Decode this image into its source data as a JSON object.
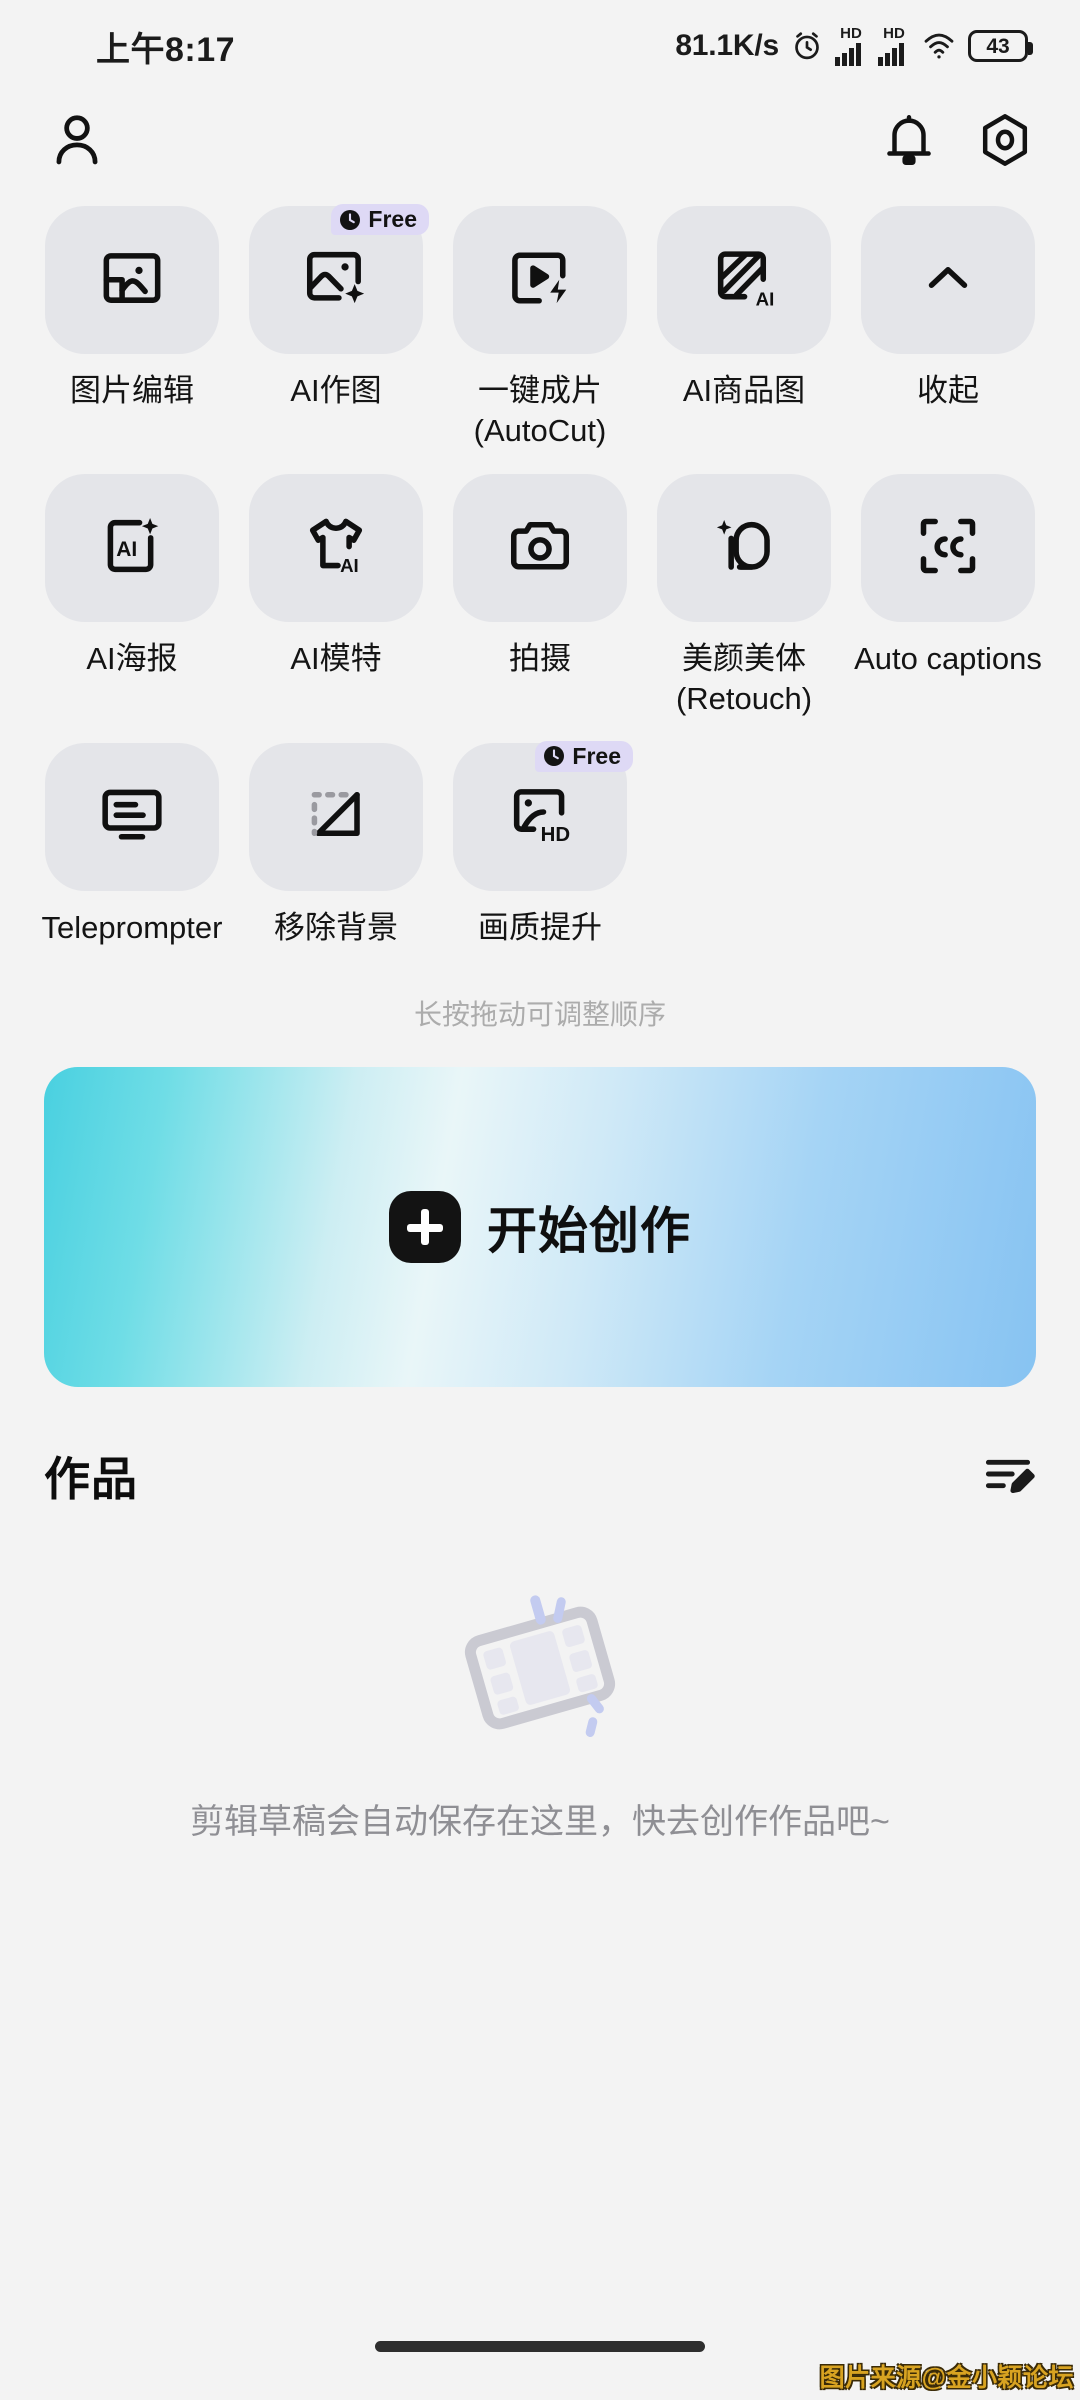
{
  "status_bar": {
    "time": "上午8:17",
    "network_speed": "81.1K/s",
    "alarm_icon": "alarm-clock-icon",
    "signal_1_label": "HD",
    "signal_2_label": "HD",
    "wifi_icon": "wifi-icon",
    "battery_level": "43"
  },
  "top_nav": {
    "profile_icon": "person-icon",
    "notification_icon": "bell-icon",
    "settings_icon": "settings-hex-icon"
  },
  "tools": [
    {
      "label": "图片编辑",
      "icon": "image-edit-icon",
      "badge": null
    },
    {
      "label": "AI作图",
      "icon": "ai-image-sparkle-icon",
      "badge": "Free"
    },
    {
      "label": "一键成片\n(AutoCut)",
      "icon": "autocut-play-bolt-icon",
      "badge": null
    },
    {
      "label": "AI商品图",
      "icon": "ai-product-image-icon",
      "badge": null
    },
    {
      "label": "收起",
      "icon": "chevron-up-icon",
      "badge": null
    },
    {
      "label": "AI海报",
      "icon": "ai-poster-icon",
      "badge": null
    },
    {
      "label": "AI模特",
      "icon": "ai-model-shirt-icon",
      "badge": null
    },
    {
      "label": "拍摄",
      "icon": "camera-icon",
      "badge": null
    },
    {
      "label": "美颜美体\n(Retouch)",
      "icon": "retouch-face-icon",
      "badge": null
    },
    {
      "label": "Auto captions",
      "icon": "closed-caption-icon",
      "badge": null
    },
    {
      "label": "Teleprompter",
      "icon": "teleprompter-icon",
      "badge": null
    },
    {
      "label": "移除背景",
      "icon": "remove-background-icon",
      "badge": null
    },
    {
      "label": "画质提升",
      "icon": "hd-enhance-icon",
      "badge": "Free"
    }
  ],
  "grid_hint": "长按拖动可调整顺序",
  "create_button": {
    "label": "开始创作",
    "icon": "plus-icon",
    "gradient_start": "#49d0e0",
    "gradient_end": "#87c3f2"
  },
  "works": {
    "title": "作品",
    "manage_icon": "edit-list-icon",
    "empty_illustration": "film-strip-icon",
    "empty_text": "剪辑草稿会自动保存在这里，快去创作作品吧~"
  },
  "watermark": "图片来源@金小颖论坛",
  "colors": {
    "page_background": "#f3f3f3",
    "tile_background": "#e4e5e9",
    "badge_background": "#ded9f5",
    "muted_text": "#8f8f94",
    "hint_text": "#acacac"
  }
}
